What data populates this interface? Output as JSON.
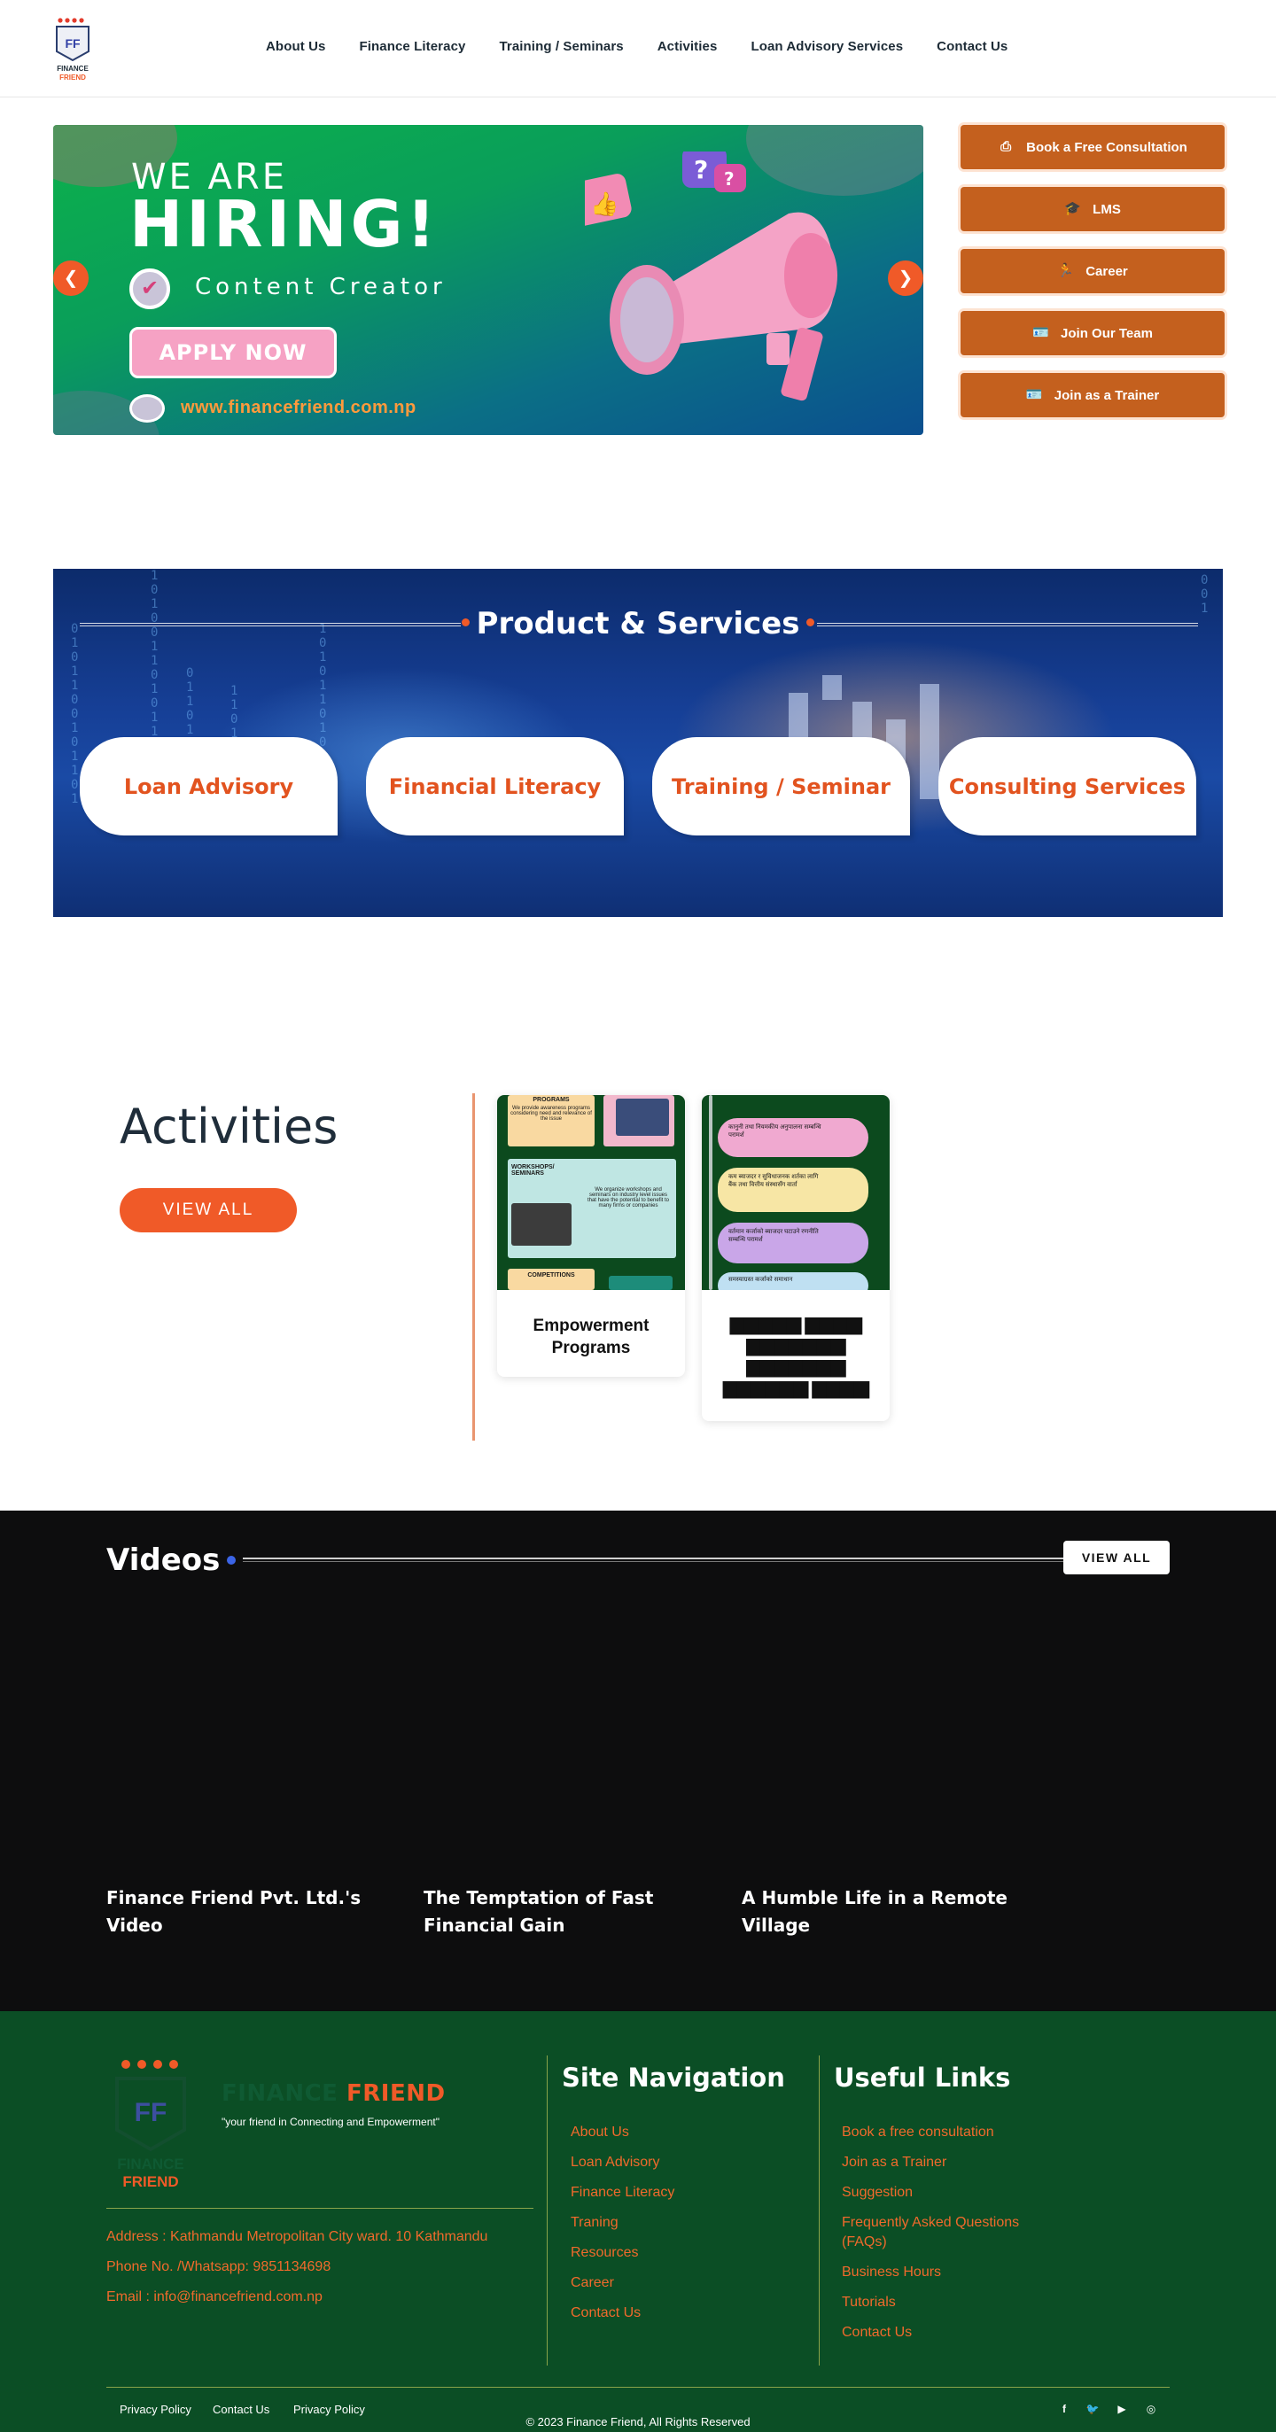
{
  "header": {
    "logo": {
      "initials": "FF",
      "line1": "FINANCE",
      "line2": "FRIEND"
    },
    "nav": [
      "About Us",
      "Finance Literacy",
      "Training / Seminars",
      "Activities",
      "Loan Advisory Services",
      "Contact Us"
    ]
  },
  "hero": {
    "line1": "WE ARE",
    "line2": "HIRING!",
    "role": "Content Creator",
    "cta": "APPLY NOW",
    "url": "www.financefriend.com.np",
    "prev_arrow": "❮",
    "next_arrow": "❯"
  },
  "side_buttons": [
    {
      "label": "Book a Free Consultation",
      "icon": "consultation-icon",
      "glyph": "⎙"
    },
    {
      "label": "LMS",
      "icon": "graduation-icon",
      "glyph": "🎓"
    },
    {
      "label": "Career",
      "icon": "running-person-icon",
      "glyph": "🏃"
    },
    {
      "label": "Join Our Team",
      "icon": "id-card-icon",
      "glyph": "🪪"
    },
    {
      "label": "Join as a Trainer",
      "icon": "id-card-icon",
      "glyph": "🪪"
    }
  ],
  "products": {
    "title": "Product & Services",
    "cards": [
      "Loan Advisory",
      "Financial Literacy",
      "Training / Seminar",
      "Consulting Services"
    ]
  },
  "activities": {
    "title": "Activities",
    "view_all": "VIEW ALL",
    "cards": [
      {
        "title": "Empowerment Programs",
        "img_labels": [
          "PROGRAMS",
          "We provide awareness programs considering need and relevance of the issue",
          "WORKSHOPS/ SEMINARS",
          "We organize workshops and seminars on industry level issues that have the potential to benefit to many firms or companies",
          "COMPETITIONS"
        ]
      },
      {
        "title": "▆▆▆▆▆ ▆▆▆▆ ▆▆▆▆▆▆▆ ▆▆▆▆▆▆▆ ▆▆▆▆▆▆ ▆▆▆▆",
        "img_labels": [
          "कानुनी तथा नियमकीय अनुपालना सम्बन्धि परामर्श",
          "कम ब्याजदर र सुविधाजनक शर्तका लागि बैंक तथा वित्तीय संस्थासँग वार्ता",
          "वर्तमान कर्जाको ब्याजदर घटाउने रणनीति सम्बन्धि परामर्श",
          "समस्याग्रस्त कर्जाको समाधान"
        ]
      }
    ]
  },
  "videos": {
    "title": "Videos",
    "view_all": "VIEW ALL",
    "items": [
      "Finance Friend Pvt. Ltd.'s Video",
      "The Temptation of Fast Financial Gain",
      "A Humble Life in a Remote Village"
    ]
  },
  "footer": {
    "brand_a": "FINANCE",
    "brand_b": "FRIEND",
    "tagline": "\"your friend in Connecting and Empowerment\"",
    "address": "Address : Kathmandu Metropolitan City ward. 10 Kathmandu",
    "phone": "Phone No. /Whatsapp: 9851134698",
    "email": "Email : info@financefriend.com.np",
    "site_nav_title": "Site Navigation",
    "site_nav": [
      "About Us",
      "Loan Advisory",
      "Finance Literacy",
      "Traning",
      "Resources",
      "Career",
      "Contact Us"
    ],
    "useful_title": "Useful Links",
    "useful": [
      "Book a free consultation",
      "Join as a Trainer",
      "Suggestion",
      "Frequently Asked Questions (FAQs)",
      "Business Hours",
      "Tutorials",
      "Contact Us"
    ],
    "legal": [
      "Privacy Policy",
      "Contact Us",
      "Privacy Policy"
    ],
    "copyright": "© 2023 Finance Friend, All Rights Reserved",
    "social": [
      {
        "name": "facebook-icon",
        "glyph": "f"
      },
      {
        "name": "twitter-icon",
        "glyph": "🐦"
      },
      {
        "name": "youtube-icon",
        "glyph": "▶"
      },
      {
        "name": "instagram-icon",
        "glyph": "◎"
      }
    ]
  },
  "colors": {
    "accent": "#f05a28",
    "button": "#c4601e",
    "footer_bg": "#0b4e25",
    "video_bg": "#0d0d0e",
    "ps_bg": "#163f96"
  }
}
